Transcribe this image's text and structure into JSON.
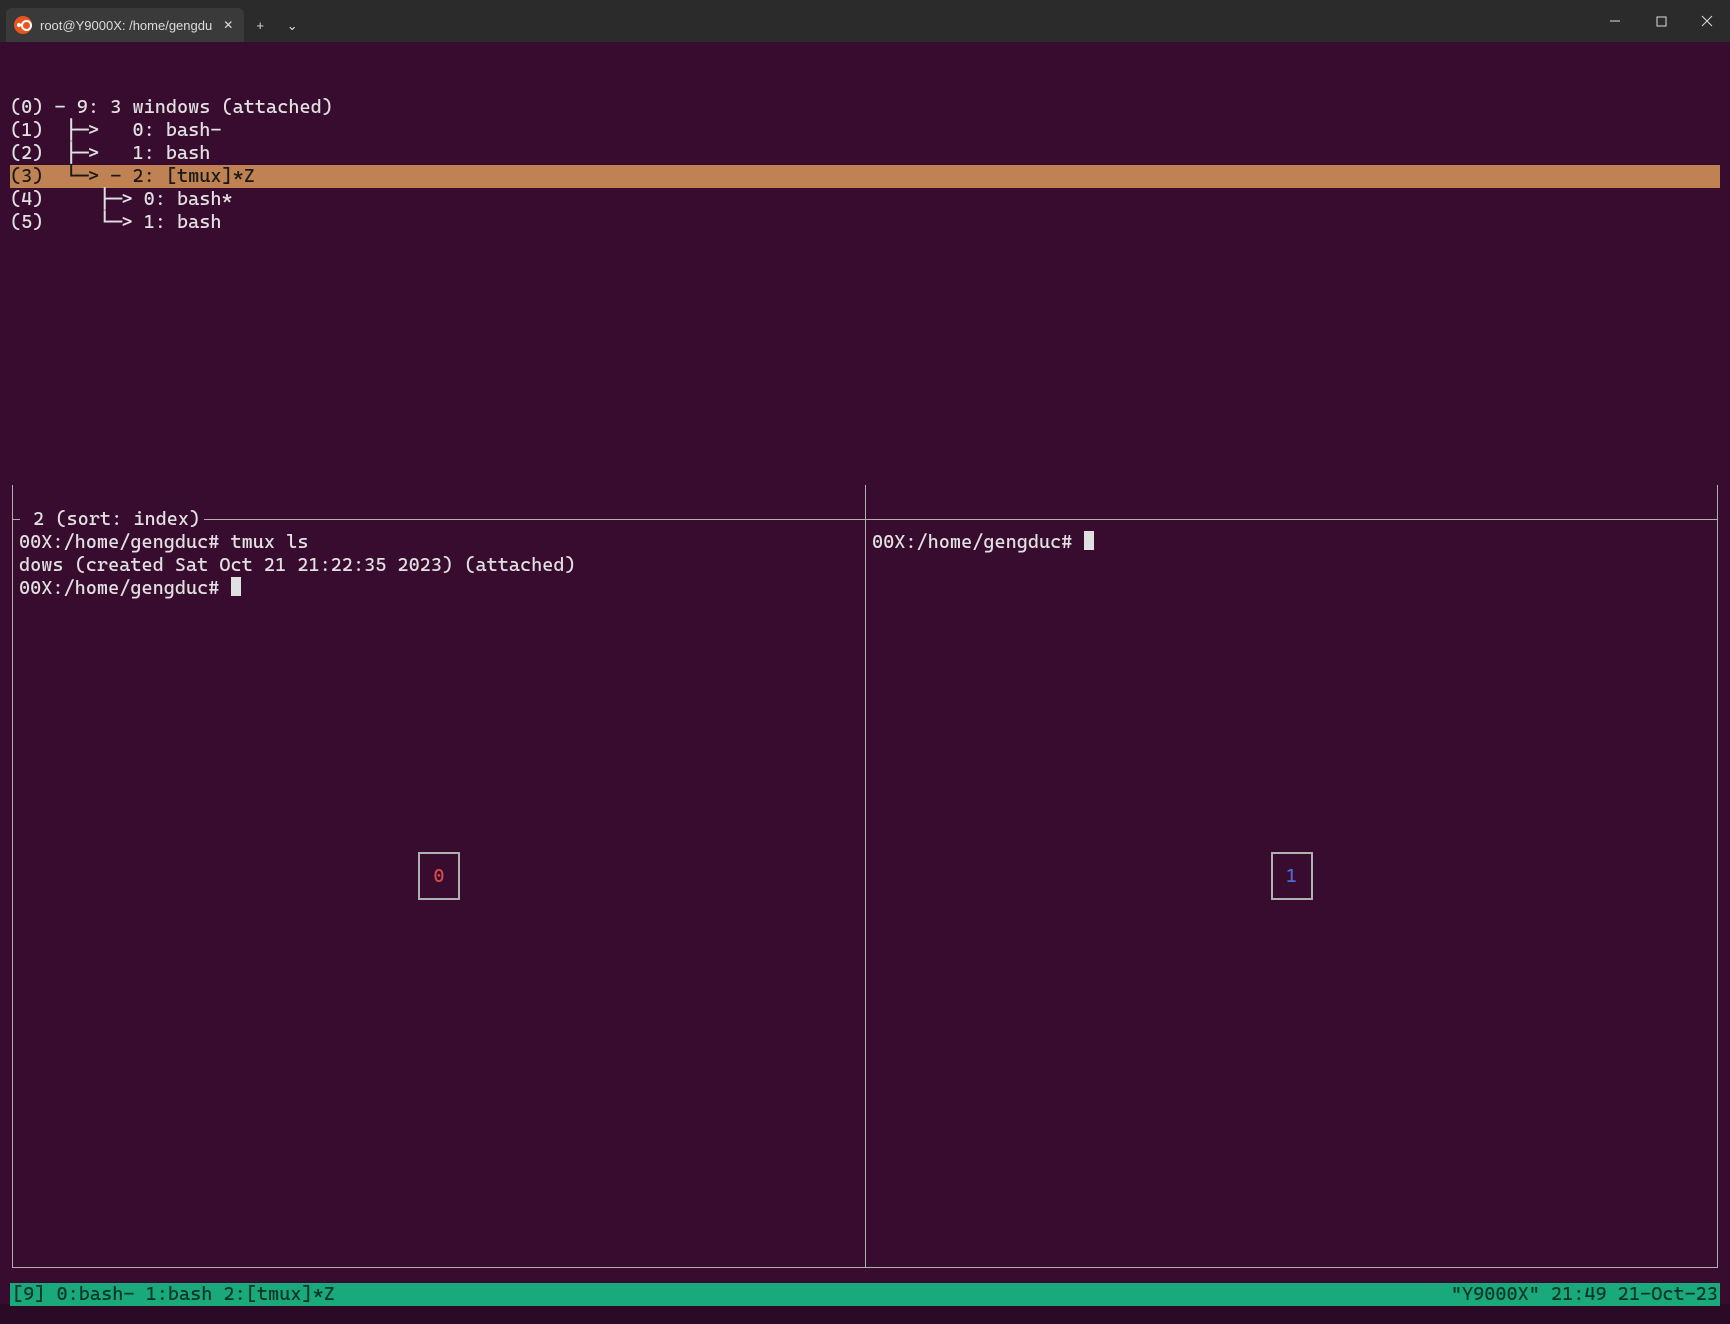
{
  "titlebar": {
    "tab_label": "root@Y9000X: /home/gengdu",
    "new_tab_glyph": "+",
    "dropdown_glyph": "⌄"
  },
  "tree": {
    "lines": [
      {
        "text": "(0) - 9: 3 windows (attached)",
        "selected": false
      },
      {
        "text": "(1)  ├─>   0: bash-",
        "selected": false
      },
      {
        "text": "(2)  ├─>   1: bash",
        "selected": false
      },
      {
        "text": "(3)  └─> - 2: [tmux]*Z",
        "selected": true
      },
      {
        "text": "(4)     ├─> 0: bash*",
        "selected": false
      },
      {
        "text": "(5)     └─> 1: bash",
        "selected": false
      }
    ]
  },
  "preview": {
    "header": " 2 (sort: index)",
    "left_pane": {
      "lines": [
        "00X:/home/gengduc# tmux ls",
        "dows (created Sat Oct 21 21:22:35 2023) (attached)",
        "00X:/home/gengduc# "
      ],
      "number": "0"
    },
    "right_pane": {
      "lines": [
        "00X:/home/gengduc# "
      ],
      "number": "1"
    }
  },
  "status": {
    "left": "[9] 0:bash- 1:bash  2:[tmux]*Z",
    "right": "\"Y9000X\" 21:49 21-Oct-23"
  }
}
